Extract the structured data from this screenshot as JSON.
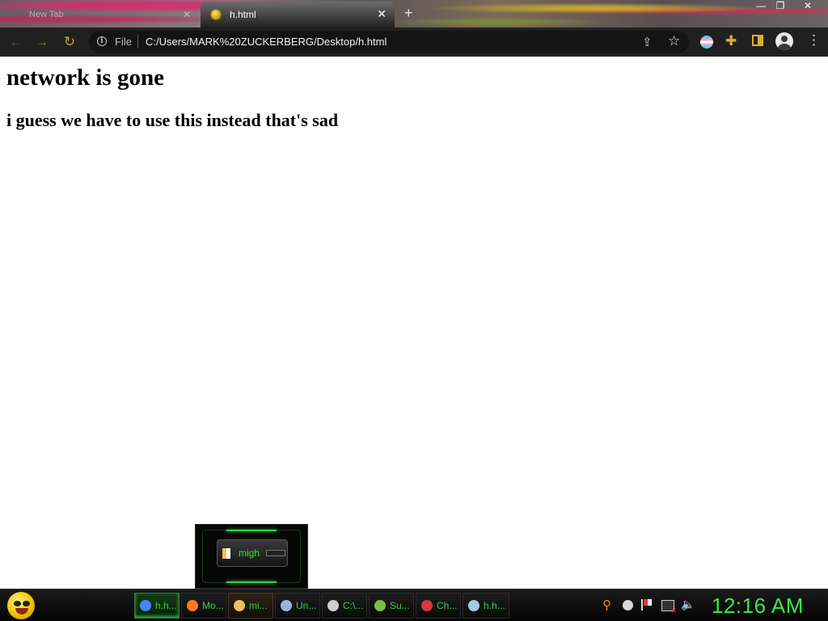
{
  "browser": {
    "tabs": [
      {
        "title": "New Tab",
        "active": false
      },
      {
        "title": "h.html",
        "active": true
      }
    ],
    "new_tab_glyph": "+",
    "close_glyph": "✕",
    "window_controls": {
      "minimize": "—",
      "restore": "❐",
      "close": "✕"
    },
    "toolbar": {
      "scheme_label": "File",
      "url": "C:/Users/MARK%20ZUCKERBERG/Desktop/h.html"
    },
    "icons": [
      "back-arrow-icon",
      "forward-arrow-icon",
      "reload-icon",
      "info-icon",
      "share-icon",
      "star-icon",
      "flag-extension-icon",
      "puzzle-icon",
      "side-panel-icon",
      "avatar-icon",
      "kebab-menu-icon"
    ]
  },
  "page": {
    "heading": "network is gone",
    "subheading": "i guess we have to use this instead that's sad"
  },
  "taskbar": {
    "tasks": [
      {
        "label": "h.h...",
        "icon": "chrome-icon",
        "color": "#4285f4",
        "state": "active"
      },
      {
        "label": "Mo...",
        "icon": "firefox-icon",
        "color": "#ff7a1a",
        "state": "normal"
      },
      {
        "label": "mi...",
        "icon": "notepad-icon",
        "color": "#f0c060",
        "state": "hover"
      },
      {
        "label": "Un...",
        "icon": "paint-icon",
        "color": "#9ab4e0",
        "state": "normal"
      },
      {
        "label": "C:\\...",
        "icon": "7zip-icon",
        "color": "#cfcfcf",
        "state": "normal"
      },
      {
        "label": "Su...",
        "icon": "sumatra-icon",
        "color": "#7ac142",
        "state": "normal"
      },
      {
        "label": "Ch...",
        "icon": "chat-icon",
        "color": "#d43a3a",
        "state": "normal"
      },
      {
        "label": "h.h...",
        "icon": "notepad-icon",
        "color": "#a8c8e8",
        "state": "normal"
      }
    ],
    "thumbnail_label": "migh",
    "clock": "12:16 AM"
  }
}
